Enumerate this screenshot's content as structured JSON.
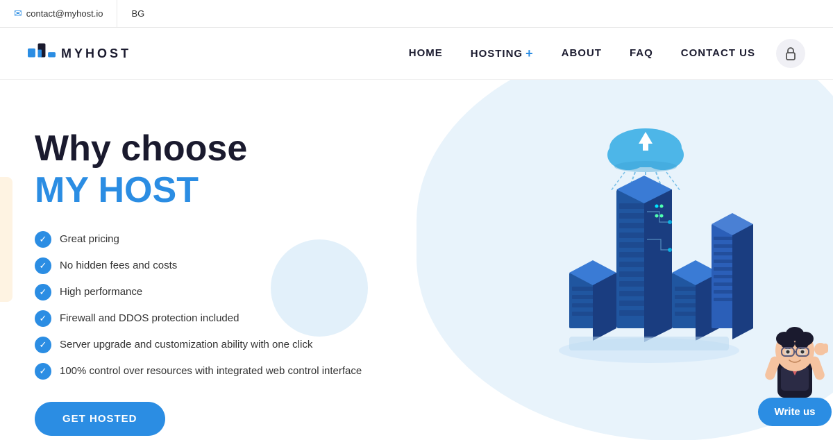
{
  "topbar": {
    "email": "contact@myhost.io",
    "lang": "BG",
    "email_icon": "✉"
  },
  "navbar": {
    "logo_text": "MYHOST",
    "links": [
      {
        "label": "HOME",
        "id": "home"
      },
      {
        "label": "HOSTING",
        "id": "hosting",
        "has_plus": true
      },
      {
        "label": "ABOUT",
        "id": "about"
      },
      {
        "label": "FAQ",
        "id": "faq"
      },
      {
        "label": "CONTACT US",
        "id": "contact"
      }
    ],
    "lock_icon": "🔒"
  },
  "hero": {
    "title_line1": "Why choose",
    "title_line2": "MY HOST",
    "features": [
      "Great pricing",
      "No hidden fees and costs",
      "High performance",
      "Firewall and DDOS protection included",
      "Server upgrade and customization ability with one click",
      "100% control over resources with integrated web control interface"
    ],
    "cta_label": "GET HOSTED",
    "write_us_label": "Write us"
  }
}
